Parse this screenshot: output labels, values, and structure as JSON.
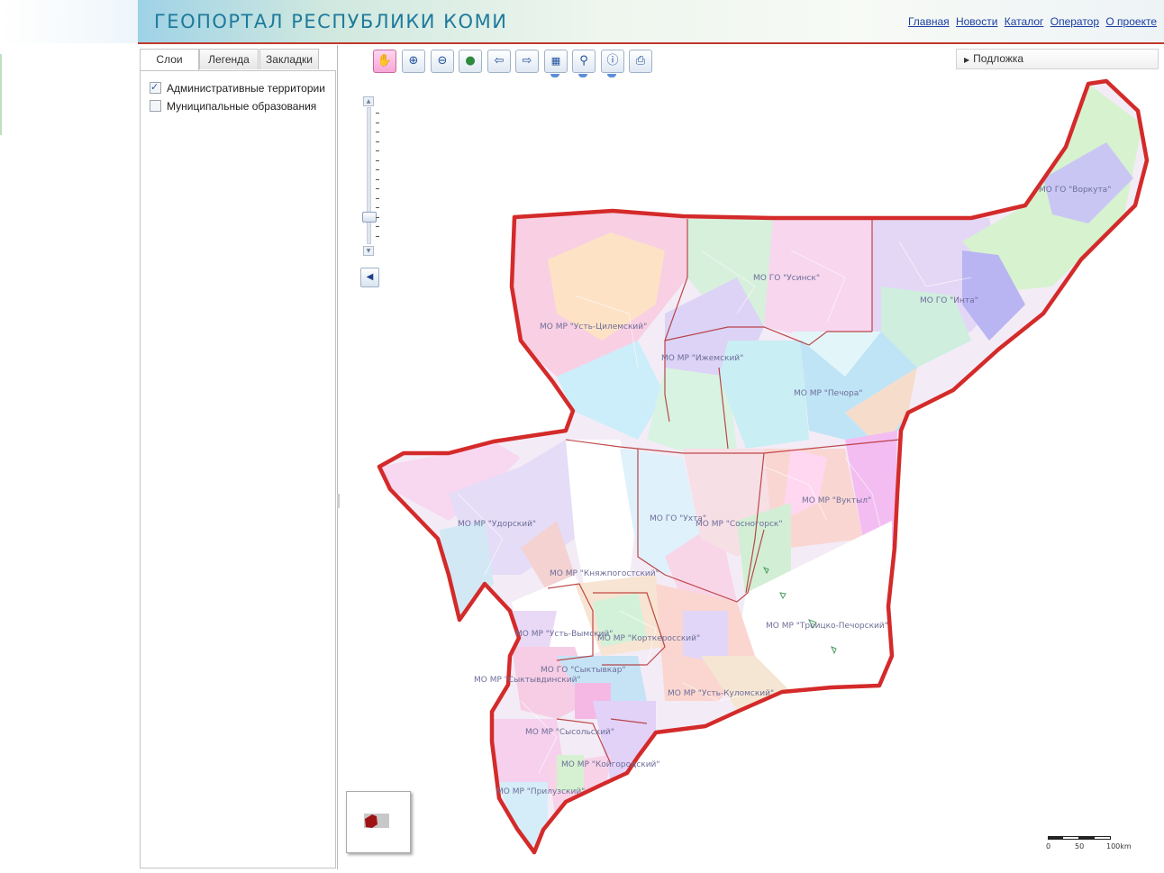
{
  "header": {
    "title": "ГЕОПОРТАЛ РЕСПУБЛИКИ КОМИ",
    "nav": [
      "Главная",
      "Новости",
      "Каталог",
      "Оператор",
      "О проекте"
    ]
  },
  "sidebar": {
    "tabs": [
      "Слои",
      "Легенда",
      "Закладки"
    ],
    "active_tab": "Слои",
    "layers": [
      {
        "label": "Административные территории",
        "checked": true
      },
      {
        "label": "Муниципальные образования",
        "checked": false
      }
    ]
  },
  "toolbar": {
    "tools": [
      "pan-hand-icon",
      "zoom-in-icon",
      "zoom-out-icon",
      "full-extent-globe-icon",
      "previous-extent-icon",
      "next-extent-icon",
      "measure-icon",
      "draw-pin-icon",
      "identify-info-icon",
      "print-icon"
    ],
    "active_tool": "pan-hand-icon"
  },
  "basemap": {
    "label": "Подложка"
  },
  "zoom": {
    "level_fraction": 0.17
  },
  "map": {
    "border_color": "#d42a2a",
    "regions": [
      "МО ГО \"Воркута\"",
      "МО ГО \"Усинск\"",
      "МО ГО \"Инта\"",
      "МО МР \"Усть-Цилемский\"",
      "МО МР \"Ижемский\"",
      "МО МР \"Печора\"",
      "МО МР \"Вуктыл\"",
      "МО МР \"Удорский\"",
      "МО ГО \"Ухта\"",
      "МО МР \"Сосногорск\"",
      "МО МР \"Княжпогостский\"",
      "МО МР \"Троицко-Печорский\"",
      "МО МР \"Усть-Вымский\"",
      "МО МР \"Корткеросский\"",
      "МО ГО \"Сыктывкар\"",
      "МО МР \"Сыктывдинский\"",
      "МО МР \"Усть-Куломский\"",
      "МО МР \"Сысольский\"",
      "МО МР \"Койгородский\"",
      "МО МР \"Прилузский\""
    ]
  },
  "scale": {
    "labels": [
      "0",
      "50",
      "100km"
    ]
  }
}
